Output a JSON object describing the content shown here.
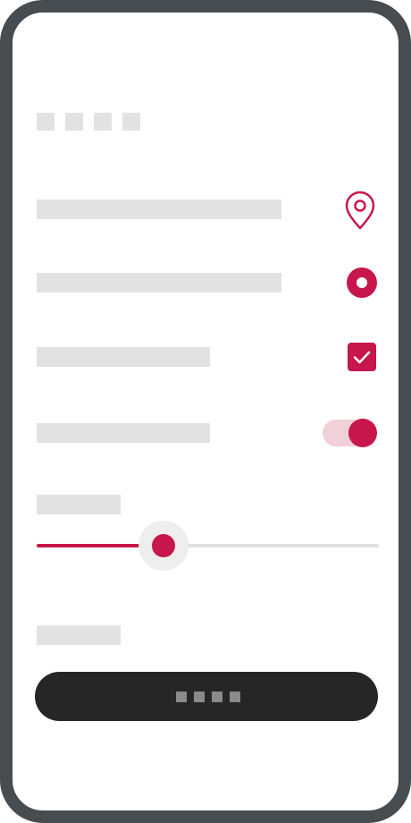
{
  "screen": {
    "title": "",
    "rows": [
      {
        "kind": "location",
        "label": "",
        "icon": "location-pin-icon"
      },
      {
        "kind": "radio",
        "label": "",
        "selected": true
      },
      {
        "kind": "checkbox",
        "label": "",
        "checked": true
      },
      {
        "kind": "toggle",
        "label": "",
        "on": true
      }
    ],
    "slider": {
      "label": "",
      "value_fraction": 0.37
    },
    "section_label": "",
    "primary_button": {
      "label": ""
    }
  },
  "colors": {
    "accent": "#c6164b",
    "accent_light": "#f2d0da",
    "frame": "#474c50",
    "placeholder": "#e2e2e2",
    "button": "#262626"
  }
}
